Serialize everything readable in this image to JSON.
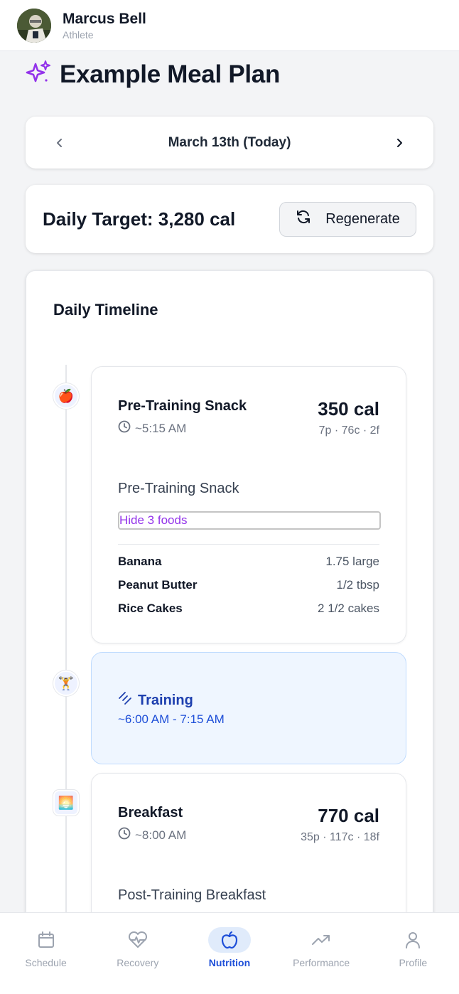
{
  "header": {
    "user_name": "Marcus Bell",
    "user_role": "Athlete"
  },
  "page": {
    "title": "Example Meal Plan",
    "title_icon": "sparkles-icon",
    "accent": "#9333ea"
  },
  "date_nav": {
    "label": "March 13th (Today)"
  },
  "target": {
    "label": "Daily Target: 3,280 cal",
    "regenerate_label": "Regenerate"
  },
  "timeline": {
    "title": "Daily Timeline",
    "pre_training": {
      "icon": "🍎",
      "name": "Pre-Training Snack",
      "time": "~5:15 AM",
      "calories": "350 cal",
      "macros": "7p · 76c · 2f",
      "subtitle": "Pre-Training Snack",
      "toggle_label": "Hide 3 foods",
      "foods": [
        {
          "name": "Banana",
          "qty": "1.75 large"
        },
        {
          "name": "Peanut Butter",
          "qty": "1/2 tbsp"
        },
        {
          "name": "Rice Cakes",
          "qty": "2 1/2 cakes"
        }
      ]
    },
    "training": {
      "icon": "🏋️",
      "title": "Training",
      "time": "~6:00 AM - 7:15 AM"
    },
    "breakfast": {
      "icon": "🌅",
      "name": "Breakfast",
      "time": "~8:00 AM",
      "calories": "770 cal",
      "macros": "35p · 117c · 18f",
      "subtitle": "Post-Training Breakfast"
    }
  },
  "bottom_nav": [
    {
      "label": "Schedule",
      "icon": "calendar-icon",
      "active": false
    },
    {
      "label": "Recovery",
      "icon": "heart-pulse-icon",
      "active": false
    },
    {
      "label": "Nutrition",
      "icon": "apple-icon",
      "active": true
    },
    {
      "label": "Performance",
      "icon": "trending-up-icon",
      "active": false
    },
    {
      "label": "Profile",
      "icon": "user-icon",
      "active": false
    }
  ]
}
